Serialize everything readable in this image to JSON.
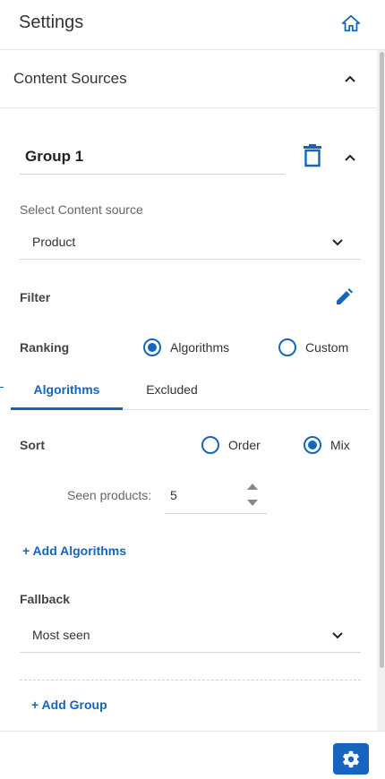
{
  "header": {
    "title": "Settings",
    "home_icon": "home-icon"
  },
  "section": {
    "title": "Content Sources",
    "collapse_icon": "chevron-up-icon"
  },
  "group": {
    "name": "Group 1",
    "delete_icon": "trash-icon",
    "collapse_icon": "chevron-up-icon",
    "content_source": {
      "label": "Select Content source",
      "value": "Product"
    },
    "filter": {
      "label": "Filter",
      "edit_icon": "pencil-icon"
    },
    "ranking": {
      "label": "Ranking",
      "options": [
        {
          "label": "Algorithms",
          "selected": true
        },
        {
          "label": "Custom",
          "selected": false
        }
      ]
    },
    "tabs": [
      {
        "label": "Algorithms",
        "active": true
      },
      {
        "label": "Excluded",
        "active": false
      }
    ],
    "sort": {
      "label": "Sort",
      "options": [
        {
          "label": "Order",
          "selected": false
        },
        {
          "label": "Mix",
          "selected": true
        }
      ]
    },
    "seen_products": {
      "label": "Seen products:",
      "value": "5"
    },
    "add_algorithms_label": "+ Add Algorithms",
    "fallback": {
      "label": "Fallback",
      "value": "Most seen"
    }
  },
  "add_group_label": "+ Add Group",
  "footer": {
    "settings_icon": "gear-icon"
  },
  "colors": {
    "accent": "#1565c0",
    "divider": "#e5e5e5",
    "text": "#333333"
  }
}
